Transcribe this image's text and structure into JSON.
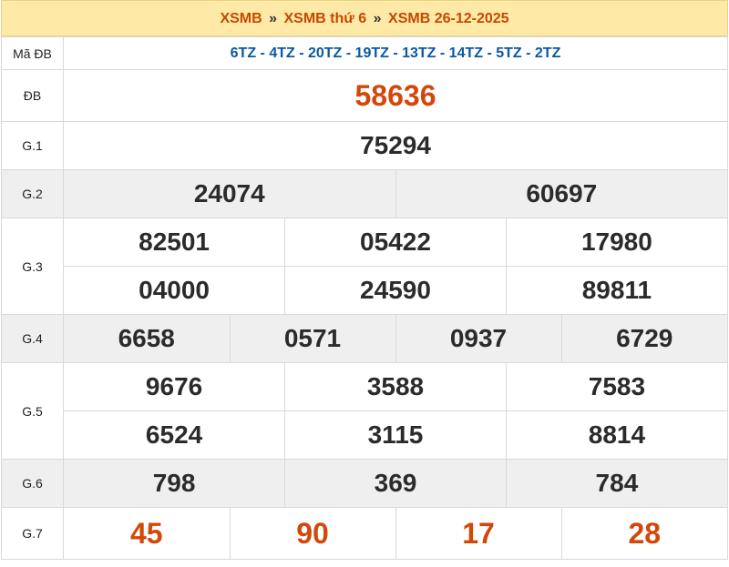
{
  "header": {
    "crumb1": "XSMB",
    "crumb2": "XSMB thứ 6",
    "crumb3": "XSMB 26-12-2025",
    "separator": "»"
  },
  "labels": {
    "code": "Mã ĐB",
    "db": "ĐB",
    "g1": "G.1",
    "g2": "G.2",
    "g3": "G.3",
    "g4": "G.4",
    "g5": "G.5",
    "g6": "G.6",
    "g7": "G.7"
  },
  "codes": "6TZ - 4TZ - 20TZ - 19TZ - 13TZ - 14TZ - 5TZ - 2TZ",
  "prizes": {
    "db": [
      "58636"
    ],
    "g1": [
      "75294"
    ],
    "g2": [
      "24074",
      "60697"
    ],
    "g3": [
      "82501",
      "05422",
      "17980",
      "04000",
      "24590",
      "89811"
    ],
    "g4": [
      "6658",
      "0571",
      "0937",
      "6729"
    ],
    "g5": [
      "9676",
      "3588",
      "7583",
      "6524",
      "3115",
      "8814"
    ],
    "g6": [
      "798",
      "369",
      "784"
    ],
    "g7": [
      "45",
      "90",
      "17",
      "28"
    ]
  },
  "colors": {
    "header_bg": "#ffe9a6",
    "header_text": "#c24a00",
    "code_text": "#0b57a4",
    "highlight_number": "#d4470a",
    "alt_row_bg": "#efefef"
  }
}
